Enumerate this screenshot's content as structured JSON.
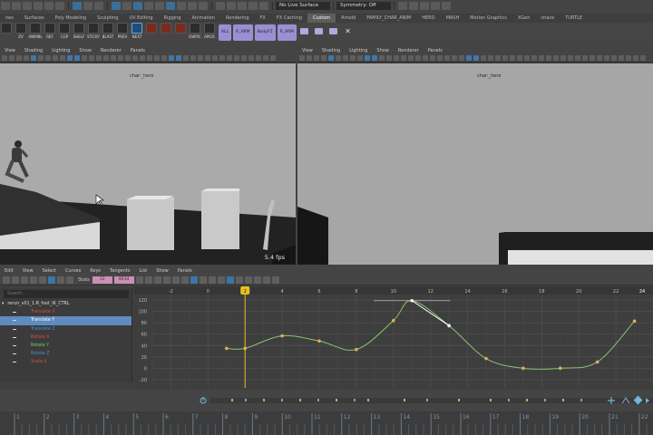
{
  "status_bar": {
    "live_surface": "No Live Surface",
    "symmetry": "Symmetry: Off"
  },
  "shelf_tabs": [
    "nes",
    "Surfaces",
    "Poly Modeling",
    "Sculpting",
    "UV Editing",
    "Rigging",
    "Animation",
    "Rendering",
    "FX",
    "FX Caching",
    "Custom",
    "Arnold",
    "FAMILY_CHAR_ANIM",
    "HERO",
    "MASH",
    "Motion Graphics",
    "XGen",
    "chace",
    "TURTLE"
  ],
  "shelf_active_tab": "Custom",
  "shelf_buttons": [
    {
      "label": "",
      "icon": "bear-icon"
    },
    {
      "label": "ZV",
      "icon": "zv-icon"
    },
    {
      "label": "ANIMBL",
      "icon": "animbl-icon"
    },
    {
      "label": "REF",
      "icon": "ref-icon"
    },
    {
      "label": "CGP",
      "icon": "cgp-icon"
    },
    {
      "label": "SHELF",
      "icon": "shelf-icon"
    },
    {
      "label": "STICKY",
      "icon": "sticky-icon"
    },
    {
      "label": "BLAST",
      "icon": "blast-icon"
    },
    {
      "label": "PREV",
      "icon": "prev-icon"
    },
    {
      "label": "NEXT",
      "icon": "next-icon"
    },
    {
      "label": "",
      "icon": "red-icon-1"
    },
    {
      "label": "",
      "icon": "red-icon-2"
    },
    {
      "label": "",
      "icon": "red-icon-3"
    },
    {
      "label": "DWPIC",
      "icon": "dwpic-icon"
    },
    {
      "label": "APICK",
      "icon": "apick-icon"
    }
  ],
  "shelf_purple_buttons": [
    "ALL",
    "R_ARM",
    "BodyFZ",
    "R_ARM"
  ],
  "viewport_menu": [
    "View",
    "Shading",
    "Lighting",
    "Show",
    "Renderer",
    "Panels"
  ],
  "viewport_left": {
    "camera_label": "char:_hero",
    "fps": "5.4 fps"
  },
  "viewport_right": {
    "camera_label": "char:_hero"
  },
  "graph_editor": {
    "menu": [
      "Edit",
      "View",
      "Select",
      "Curves",
      "Keys",
      "Tangents",
      "List",
      "Show",
      "Panels"
    ],
    "stats_label": "Stats",
    "stats_values": [
      "12",
      "8634"
    ],
    "search_placeholder": "Search...",
    "outliner_root": "rerun_v01_1:R_foot_IK_CTRL",
    "channels": [
      {
        "name": "Translate X",
        "color": "#e04a3a",
        "selected": false
      },
      {
        "name": "Translate Y",
        "color": "#a8ff8a",
        "selected": true
      },
      {
        "name": "Translate Z",
        "color": "#4a8fe0",
        "selected": false
      },
      {
        "name": "Rotate X",
        "color": "#e04a3a",
        "selected": false
      },
      {
        "name": "Rotate Y",
        "color": "#6ad64a",
        "selected": false
      },
      {
        "name": "Rotate Z",
        "color": "#4a8fe0",
        "selected": false
      },
      {
        "name": "Scale X",
        "color": "#e04a3a",
        "selected": false
      }
    ],
    "frame_ticks": [
      "-2",
      "0",
      "2",
      "4",
      "6",
      "8",
      "10",
      "12",
      "14",
      "16",
      "18",
      "20",
      "22"
    ],
    "value_ticks": [
      "120",
      "100",
      "80",
      "60",
      "40",
      "20",
      "0",
      "-20"
    ],
    "current_frame_label": "2",
    "right_frame_label": "24"
  },
  "chart_data": {
    "type": "line",
    "title": "",
    "xlabel": "",
    "ylabel": "",
    "xlim": [
      -3,
      24
    ],
    "ylim": [
      -25,
      125
    ],
    "current_frame": 2,
    "series": [
      {
        "name": "Translate Y",
        "color": "#88c470",
        "x": [
          1,
          2,
          4,
          6,
          8,
          10,
          11,
          13,
          15,
          17,
          19,
          21,
          23
        ],
        "y": [
          35,
          35,
          57,
          48,
          33,
          84,
          119,
          75,
          17,
          0,
          0,
          11,
          83
        ]
      }
    ]
  },
  "time_slider": {
    "ticks": [
      "1",
      "2",
      "3",
      "4",
      "5",
      "6",
      "7",
      "8",
      "9",
      "10",
      "11",
      "12",
      "13",
      "14",
      "15",
      "16",
      "17",
      "18",
      "19",
      "20",
      "21",
      "22"
    ]
  }
}
